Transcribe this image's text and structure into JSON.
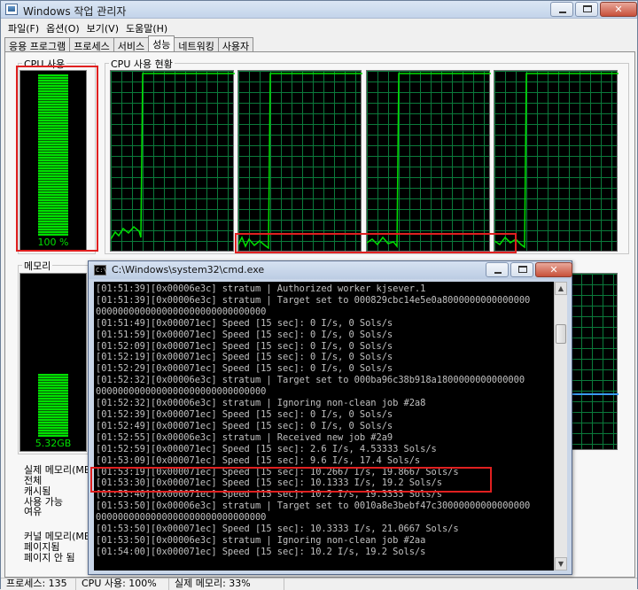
{
  "task_manager": {
    "title": "Windows 작업 관리자",
    "menu": [
      "파일(F)",
      "옵션(O)",
      "보기(V)",
      "도움말(H)"
    ],
    "tabs": [
      "응용 프로그램",
      "프로세스",
      "서비스",
      "성능",
      "네트워킹",
      "사용자"
    ],
    "active_tab": "성능",
    "cpu_usage_label": "CPU 사용",
    "cpu_usage_value": "100 %",
    "cpu_usage_fraction": 1.0,
    "cpu_history_label": "CPU 사용 현황",
    "memory_label": "메모리",
    "memory_value": "5.32GB",
    "memory_fraction": 0.4,
    "physical_memory_labels": [
      "실제 메모리(MB)",
      "전체",
      "캐시됨",
      "사용 가능",
      "여유"
    ],
    "kernel_memory_labels": [
      "커널 메모리(MB)",
      "페이지됨",
      "페이지 안 됨"
    ],
    "status": {
      "processes": "프로세스: 135",
      "cpu": "CPU 사용: 100%",
      "memory": "실제 메모리: 33%"
    },
    "colors": {
      "graph_line": "#00e000",
      "grid": "#0b7a3b",
      "highlight": "#e02020"
    }
  },
  "cmd": {
    "title": "C:\\Windows\\system32\\cmd.exe",
    "lines": [
      "[01:51:39][0x00006e3c] stratum | Authorized worker kjsever.1",
      "[01:51:39][0x00006e3c] stratum | Target set to 000829cbc14e5e0a8000000000000000",
      "0000000000000000000000000000000",
      "[01:51:49][0x000071ec] Speed [15 sec]: 0 I/s, 0 Sols/s",
      "[01:51:59][0x000071ec] Speed [15 sec]: 0 I/s, 0 Sols/s",
      "[01:52:09][0x000071ec] Speed [15 sec]: 0 I/s, 0 Sols/s",
      "[01:52:19][0x000071ec] Speed [15 sec]: 0 I/s, 0 Sols/s",
      "[01:52:29][0x000071ec] Speed [15 sec]: 0 I/s, 0 Sols/s",
      "[01:52:32][0x00006e3c] stratum | Target set to 000ba96c38b918a1800000000000000",
      "0000000000000000000000000000000",
      "[01:52:32][0x00006e3c] stratum | Ignoring non-clean job #2a8",
      "[01:52:39][0x000071ec] Speed [15 sec]: 0 I/s, 0 Sols/s",
      "[01:52:49][0x000071ec] Speed [15 sec]: 0 I/s, 0 Sols/s",
      "[01:52:55][0x00006e3c] stratum | Received new job #2a9",
      "[01:52:59][0x000071ec] Speed [15 sec]: 2.6 I/s, 4.53333 Sols/s",
      "[01:53:09][0x000071ec] Speed [15 sec]: 9.6 I/s, 17.4 Sols/s",
      "[01:53:19][0x000071ec] Speed [15 sec]: 10.2667 I/s, 19.8667 Sols/s",
      "[01:53:30][0x000071ec] Speed [15 sec]: 10.1333 I/s, 19.2 Sols/s",
      "[01:53:40][0x000071ec] Speed [15 sec]: 10.2 I/s, 19.3333 Sols/s",
      "[01:53:50][0x00006e3c] stratum | Target set to 0010a8e3bebf47c30000000000000000",
      "0000000000000000000000000000000",
      "[01:53:50][0x000071ec] Speed [15 sec]: 10.3333 I/s, 21.0667 Sols/s",
      "[01:53:50][0x00006e3c] stratum | Ignoring non-clean job #2aa",
      "[01:54:00][0x000071ec] Speed [15 sec]: 10.2 I/s, 19.2 Sols/s"
    ]
  }
}
